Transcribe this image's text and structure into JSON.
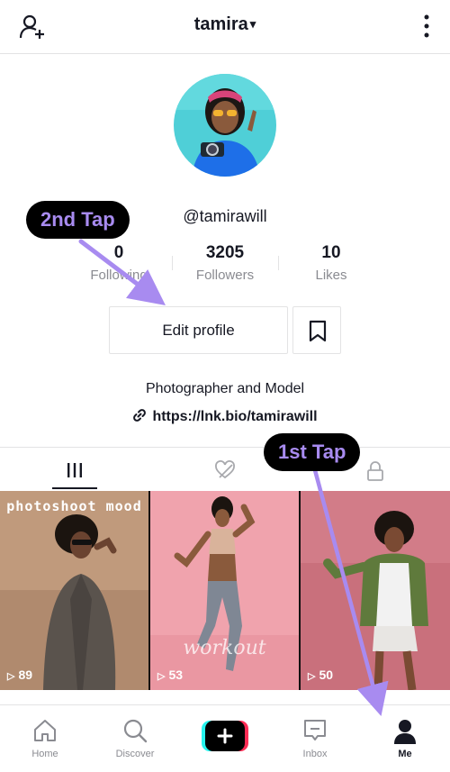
{
  "header": {
    "username": "tamira",
    "caret": "▾",
    "add_user_icon": "person-add-icon",
    "more_icon": "more-vertical-icon"
  },
  "profile": {
    "handle": "@tamirawill",
    "stats": [
      {
        "value": "0",
        "label": "Following"
      },
      {
        "value": "3205",
        "label": "Followers"
      },
      {
        "value": "10",
        "label": "Likes"
      }
    ],
    "edit_label": "Edit profile",
    "bio": "Photographer and Model",
    "link": "https://lnk.bio/tamirawill"
  },
  "tabs": [
    {
      "icon": "grid-icon",
      "active": true
    },
    {
      "icon": "liked-hidden-icon",
      "active": false
    },
    {
      "icon": "lock-icon",
      "active": false
    }
  ],
  "videos": [
    {
      "overlay": "photoshoot mood",
      "views": "89"
    },
    {
      "overlay": "workout",
      "views": "53"
    },
    {
      "overlay": "",
      "views": "50"
    }
  ],
  "nav": [
    {
      "label": "Home",
      "icon": "home-icon"
    },
    {
      "label": "Discover",
      "icon": "search-icon"
    },
    {
      "label": "",
      "icon": "plus-icon"
    },
    {
      "label": "Inbox",
      "icon": "inbox-icon"
    },
    {
      "label": "Me",
      "icon": "person-icon"
    }
  ],
  "callouts": {
    "first": "1st Tap",
    "second": "2nd Tap"
  },
  "colors": {
    "accent_purple": "#a88bf0",
    "text": "#161823",
    "muted": "#8a8b91",
    "cyan": "#25f4ee",
    "red": "#fe2c55"
  }
}
